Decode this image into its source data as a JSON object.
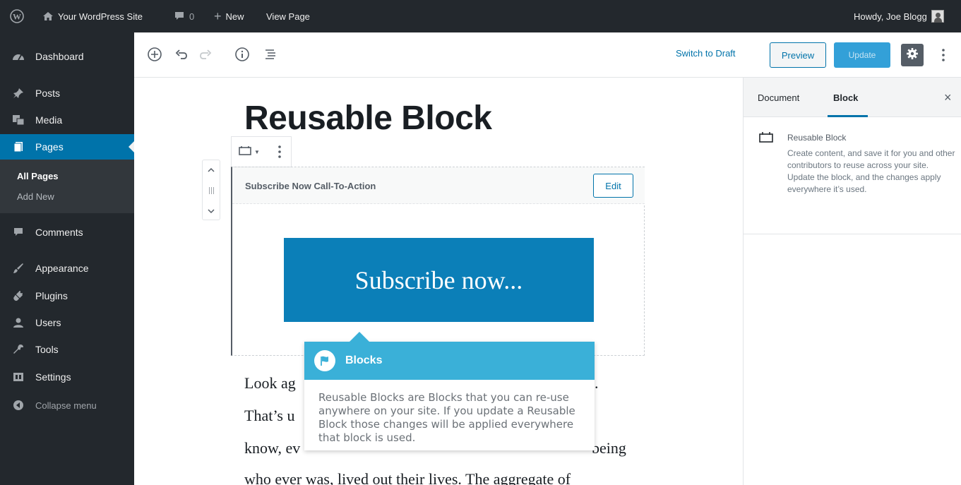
{
  "admin_bar": {
    "site_name": "Your WordPress Site",
    "comments_count": "0",
    "new_label": "New",
    "view_page_label": "View Page",
    "greeting": "Howdy, Joe Blogg"
  },
  "sidebar": {
    "items": [
      {
        "label": "Dashboard",
        "icon": "dashboard-icon"
      },
      {
        "label": "Posts",
        "icon": "pin-icon"
      },
      {
        "label": "Media",
        "icon": "media-icon"
      },
      {
        "label": "Pages",
        "icon": "pages-icon"
      },
      {
        "label": "Comments",
        "icon": "comment-icon"
      },
      {
        "label": "Appearance",
        "icon": "brush-icon"
      },
      {
        "label": "Plugins",
        "icon": "plug-icon"
      },
      {
        "label": "Users",
        "icon": "users-icon"
      },
      {
        "label": "Tools",
        "icon": "wrench-icon"
      },
      {
        "label": "Settings",
        "icon": "settings-icon"
      },
      {
        "label": "Collapse menu",
        "icon": "collapse-icon"
      }
    ],
    "submenu": [
      "All Pages",
      "Add New"
    ],
    "accent": "#0073aa"
  },
  "editor_header": {
    "switch_to_draft": "Switch to Draft",
    "preview": "Preview",
    "update": "Update"
  },
  "content": {
    "title": "Reusable Block",
    "reusable_block_title": "Subscribe Now Call-To-Action",
    "edit_label": "Edit",
    "subscribe_text": "Subscribe now...",
    "paragraph_lines": [
      "Look ag",
      "That’s u",
      "know, ev",
      "who ever was, lived out their lives. The aggregate of"
    ],
    "paragraph_right_fragments": [
      ".",
      "being"
    ]
  },
  "tooltip": {
    "title": "Blocks",
    "body": "Reusable Blocks are Blocks that you can re-use anywhere on your site. If you update a Reusable Block those changes will be applied everywhere that block is used.",
    "color": "#3ab0d8"
  },
  "settings_sidebar": {
    "tabs": [
      "Document",
      "Block"
    ],
    "active_tab": "Block",
    "block_name": "Reusable Block",
    "block_description": "Create content, and save it for you and other contributors to reuse across your site. Update the block, and the changes apply everywhere it’s used."
  }
}
